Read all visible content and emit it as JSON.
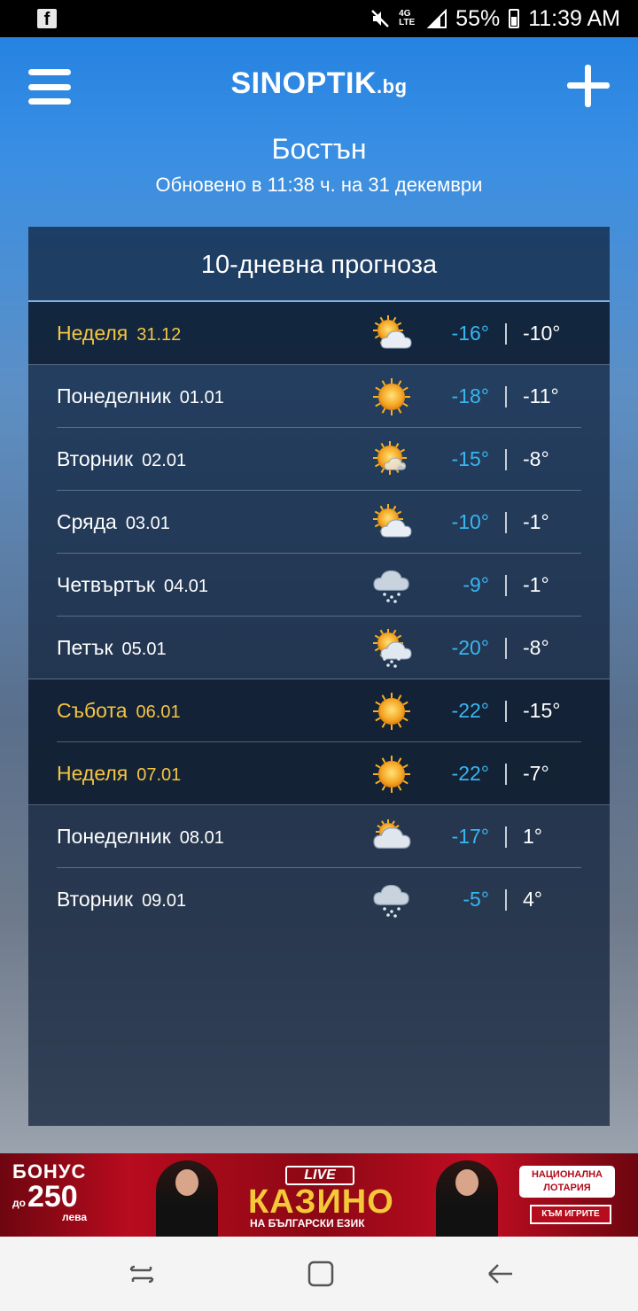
{
  "status_bar": {
    "left_icon": "facebook-icon",
    "network": "4G LTE",
    "battery": "55%",
    "time": "11:39 AM"
  },
  "header": {
    "logo_main": "SINOPTIK",
    "logo_suffix": ".bg",
    "city": "Бостън",
    "updated": "Обновено в 11:38 ч. на 31 декември"
  },
  "forecast": {
    "title": "10-дневна прогноза",
    "days": [
      {
        "day": "Неделя",
        "date": "31.12",
        "icon": "partly-cloudy-icon",
        "min": "-16°",
        "max": "-10°",
        "weekend": true
      },
      {
        "day": "Понеделник",
        "date": "01.01",
        "icon": "sunny-icon",
        "min": "-18°",
        "max": "-11°",
        "weekend": false
      },
      {
        "day": "Вторник",
        "date": "02.01",
        "icon": "sun-light-cloud-icon",
        "min": "-15°",
        "max": "-8°",
        "weekend": false
      },
      {
        "day": "Сряда",
        "date": "03.01",
        "icon": "partly-cloudy-icon",
        "min": "-10°",
        "max": "-1°",
        "weekend": false
      },
      {
        "day": "Четвъртък",
        "date": "04.01",
        "icon": "cloud-snow-icon",
        "min": "-9°",
        "max": "-1°",
        "weekend": false
      },
      {
        "day": "Петък",
        "date": "05.01",
        "icon": "sun-cloud-snow-icon",
        "min": "-20°",
        "max": "-8°",
        "weekend": false
      },
      {
        "day": "Събота",
        "date": "06.01",
        "icon": "sunny-icon",
        "min": "-22°",
        "max": "-15°",
        "weekend": true
      },
      {
        "day": "Неделя",
        "date": "07.01",
        "icon": "sunny-icon",
        "min": "-22°",
        "max": "-7°",
        "weekend": true
      },
      {
        "day": "Понеделник",
        "date": "08.01",
        "icon": "cloudy-icon",
        "min": "-17°",
        "max": "1°",
        "weekend": false
      },
      {
        "day": "Вторник",
        "date": "09.01",
        "icon": "cloud-snow-icon",
        "min": "-5°",
        "max": "4°",
        "weekend": false
      }
    ]
  },
  "ad": {
    "bonus_label": "БОНУС",
    "bonus_prefix": "до",
    "bonus_amount": "250",
    "bonus_unit": "лева",
    "live_label": "LIVE",
    "casino_label": "КАЗИНО",
    "casino_sub": "НА БЪЛГАРСКИ ЕЗИК",
    "lottery_label": "НАЦИОНАЛНА ЛОТАРИЯ",
    "cta_label": "КЪМ ИГРИТЕ"
  }
}
